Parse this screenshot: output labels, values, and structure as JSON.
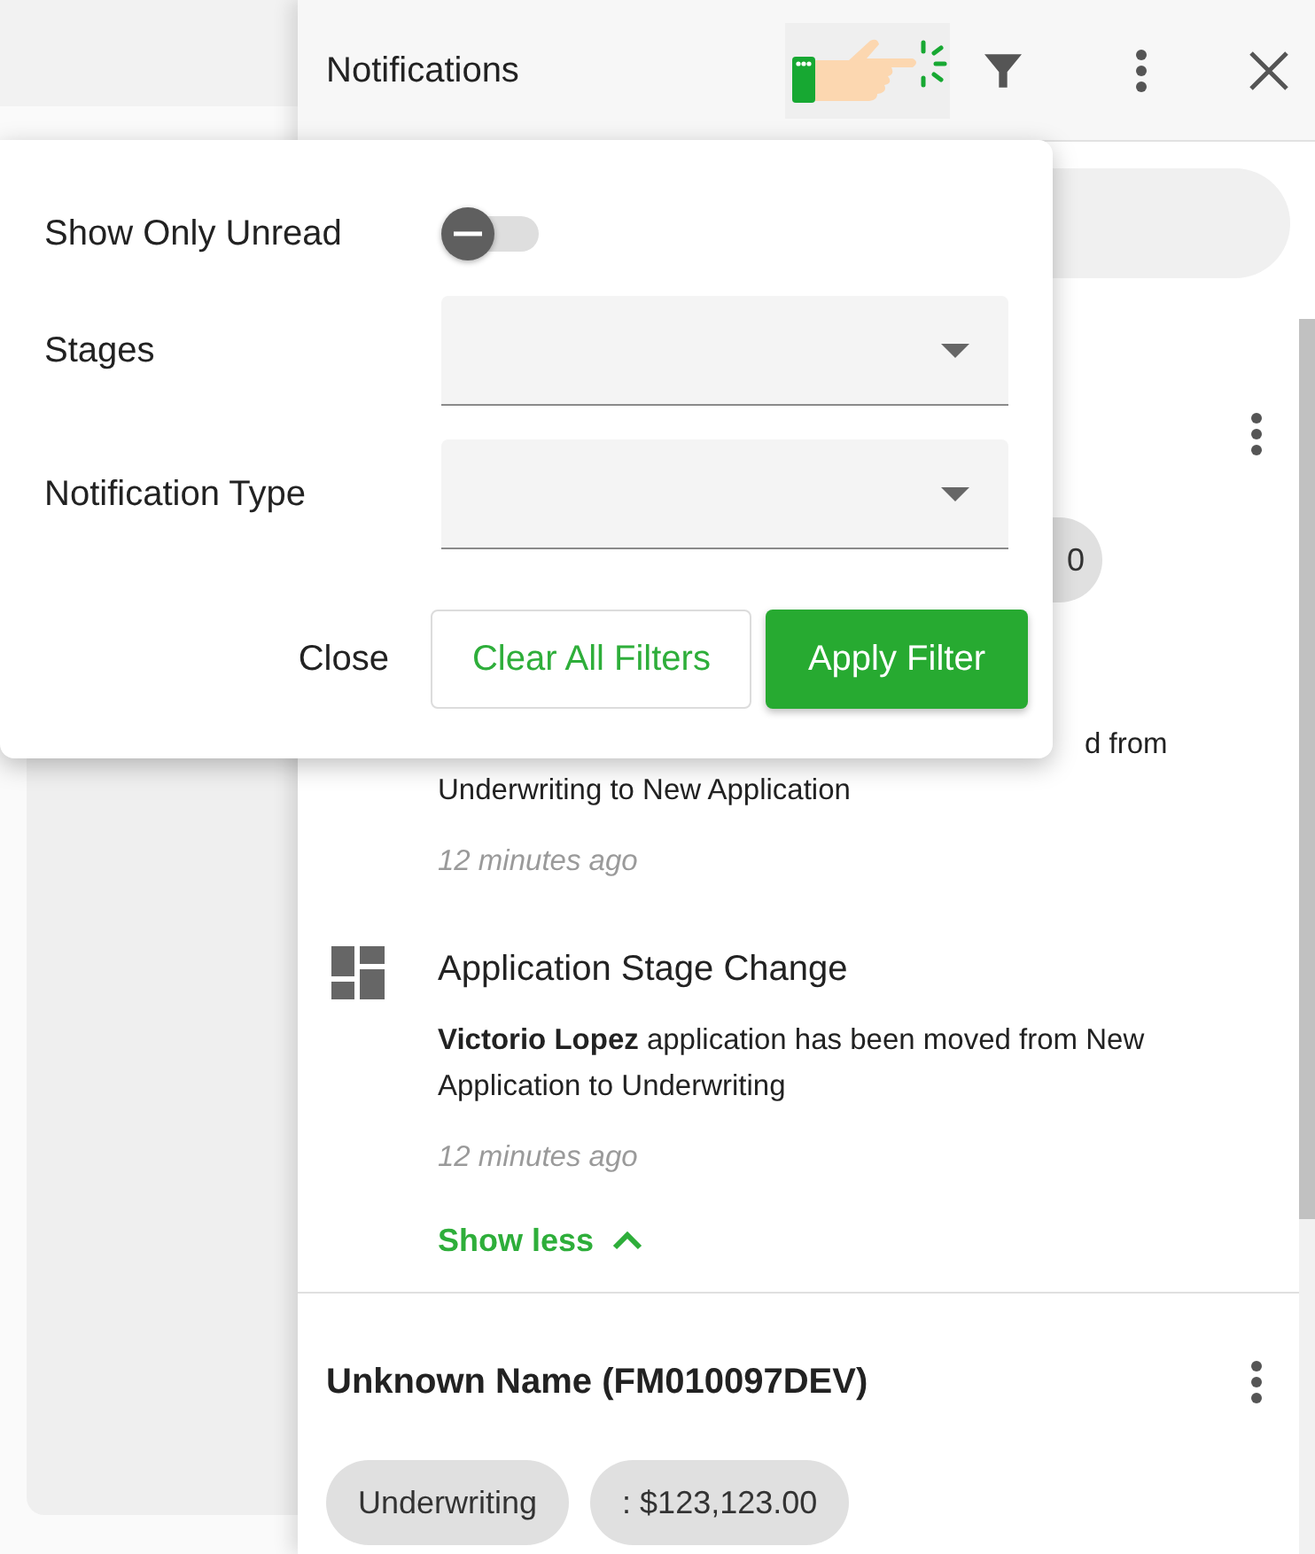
{
  "header": {
    "title": "Notifications"
  },
  "filter_popover": {
    "show_only_unread": {
      "label": "Show Only Unread",
      "on": false
    },
    "fields": [
      {
        "label": "Stages"
      },
      {
        "label": "Notification Type"
      }
    ],
    "buttons": [
      {
        "label": "Close",
        "kind": "text"
      },
      {
        "label": "Clear All Filters",
        "kind": "outline"
      },
      {
        "label": "Apply Filter",
        "kind": "primary"
      }
    ]
  },
  "cards": [
    {
      "chips": [
        "0"
      ],
      "items": [
        {
          "body_lines": [
            "d from",
            "Underwriting to New Application"
          ],
          "time": "12 minutes ago"
        },
        {
          "title": "Application Stage Change",
          "body": "**Victorio Lopez** application has been moved from New Application to Underwriting",
          "time": "12 minutes ago"
        }
      ],
      "toggle": "Show less"
    },
    {
      "title": "Unknown Name (FM010097DEV)",
      "chips": [
        "Underwriting",
        ": $123,123.00"
      ]
    }
  ]
}
